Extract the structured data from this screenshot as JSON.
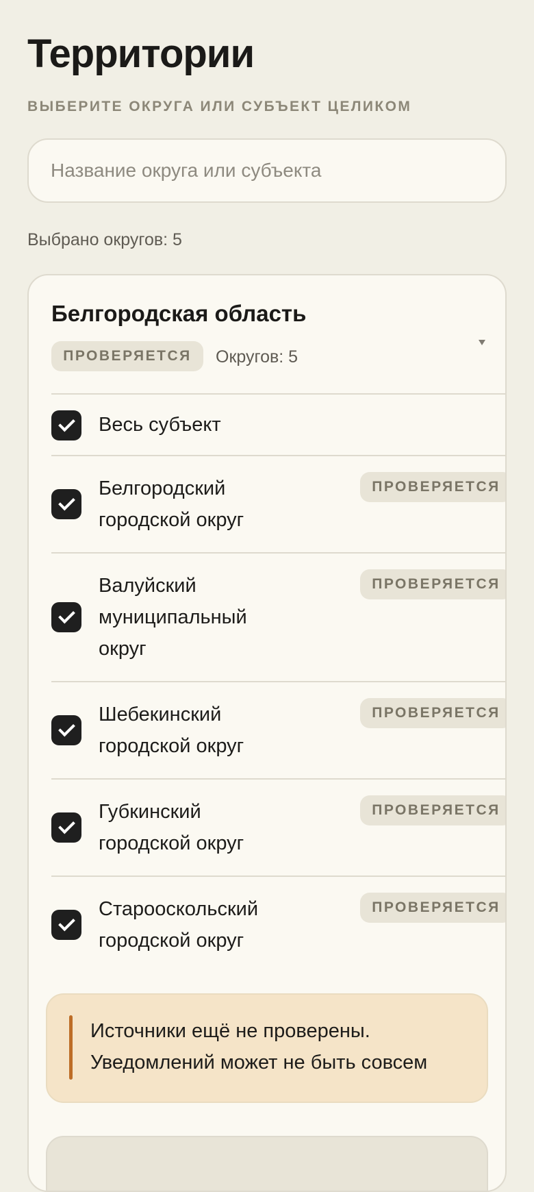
{
  "header": {
    "title": "Территории",
    "subtitle": "ВЫБЕРИТЕ ОКРУГА ИЛИ СУБЪЕКТ ЦЕЛИКОМ"
  },
  "search": {
    "placeholder": "Название округа или субъекта",
    "value": ""
  },
  "selection": {
    "summary": "Выбрано округов: 5"
  },
  "region": {
    "name": "Белгородская область",
    "status": "ПРОВЕРЯЕТСЯ",
    "district_count": "Округов: 5",
    "whole_subject": {
      "label": "Весь субъект",
      "checked": true
    },
    "districts": [
      {
        "label": "Белгородский городской округ",
        "status": "ПРОВЕРЯЕТСЯ",
        "checked": true
      },
      {
        "label": "Валуйский муниципальный округ",
        "status": "ПРОВЕРЯЕТСЯ",
        "checked": true
      },
      {
        "label": "Шебекинский городской округ",
        "status": "ПРОВЕРЯЕТСЯ",
        "checked": true
      },
      {
        "label": "Губкинский городской округ",
        "status": "ПРОВЕРЯЕТСЯ",
        "checked": true
      },
      {
        "label": "Старооскольский городской округ",
        "status": "ПРОВЕРЯЕТСЯ",
        "checked": true
      }
    ]
  },
  "notice": {
    "text": "Источники ещё не проверены. Уведомлений может не быть совсем"
  },
  "colors": {
    "background": "#f1efe5",
    "card": "#fbf9f2",
    "checkbox": "#1f1f1f",
    "notice_background": "#f5e4c8",
    "notice_accent": "#bd6d27",
    "status_pill": "#e8e4d7"
  },
  "icons": {
    "checkbox": "check-icon",
    "collapse": "chevron-down-icon"
  }
}
